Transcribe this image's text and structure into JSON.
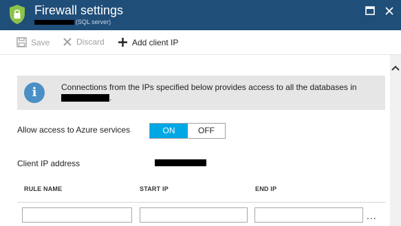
{
  "header": {
    "title": "Firewall settings",
    "subtitle_suffix": "(SQL server)",
    "icons": {
      "app": "shield-lock-icon",
      "maximize": "maximize-icon",
      "close": "close-icon"
    }
  },
  "toolbar": {
    "save_label": "Save",
    "discard_label": "Discard",
    "add_client_ip_label": "Add client IP"
  },
  "info": {
    "text": "Connections from the IPs specified below provides access to all the databases in",
    "trailing": "."
  },
  "azure_access": {
    "label": "Allow access to Azure services",
    "on_label": "ON",
    "off_label": "OFF",
    "selected": "ON"
  },
  "client_ip": {
    "label": "Client IP address"
  },
  "rules_table": {
    "columns": [
      "RULE NAME",
      "START IP",
      "END IP"
    ],
    "row": {
      "rule_name": "",
      "start_ip": "",
      "end_ip": ""
    },
    "more_label": "..."
  },
  "colors": {
    "titlebar": "#1f4e79",
    "toggle_on": "#00a7e5",
    "info_bg": "#e6e6e6",
    "info_icon": "#4a90c6",
    "shield": "#8bc34a"
  }
}
